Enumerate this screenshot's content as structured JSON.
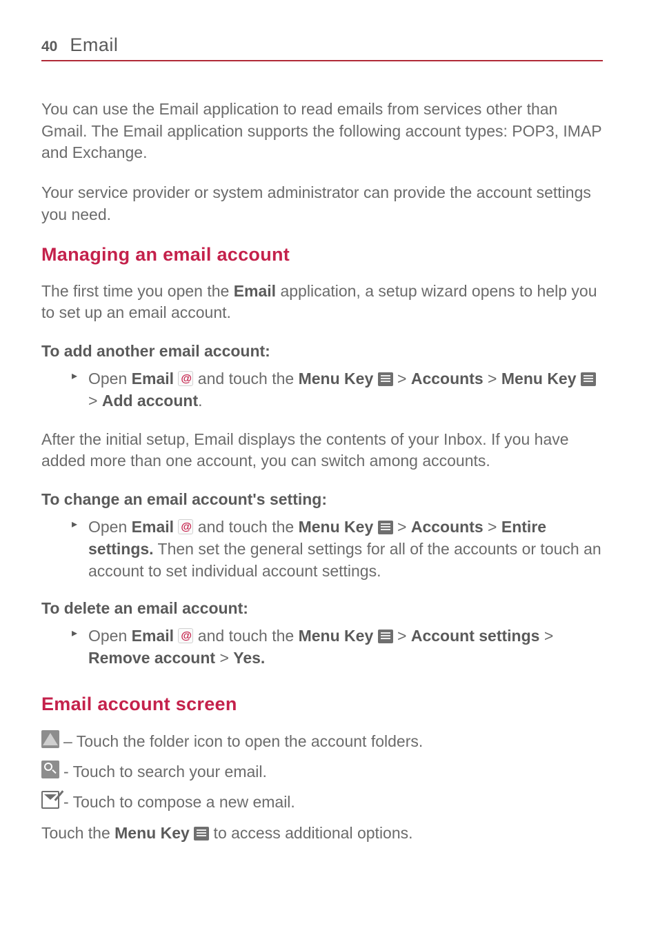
{
  "header": {
    "page_number": "40",
    "chapter": "Email"
  },
  "intro": {
    "p1": "You can use the Email application to read emails from services other than Gmail. The Email application supports the following account types: POP3, IMAP and Exchange.",
    "p2": "Your service provider or system administrator can provide the account settings you need."
  },
  "section_managing": {
    "title": "Managing an email account",
    "intro_pre": "The first time you open the ",
    "intro_bold": "Email",
    "intro_post": " application, a setup wizard opens to help you to set up an email account.",
    "add": {
      "heading": "To add another email account:",
      "s1": "Open ",
      "s2": "Email ",
      "s3": " and touch the ",
      "s4": "Menu Key ",
      "s5": " > ",
      "s6": "Accounts",
      "s7": " > ",
      "s8": "Menu Key ",
      "s9": " > ",
      "s10": "Add account",
      "s11": "."
    },
    "after": "After the initial setup, Email displays the contents of your Inbox. If you have added more than one account, you can switch among accounts.",
    "change": {
      "heading": "To change an email account's setting:",
      "s1": "Open ",
      "s2": "Email ",
      "s3": " and touch the ",
      "s4": "Menu Key ",
      "s5": " > ",
      "s6": "Accounts",
      "s7": " > ",
      "s8": "Entire settings.",
      "s9": " Then set the general settings for all of the accounts or touch an account to set individual account settings."
    },
    "delete": {
      "heading": "To delete an email account:",
      "s1": "Open ",
      "s2": "Email ",
      "s3": " and touch the ",
      "s4": "Menu Key ",
      "s5": " > ",
      "s6": "Account settings",
      "s7": " > ",
      "s8": "Remove account",
      "s9": " > ",
      "s10": "Yes.",
      "s11": ""
    }
  },
  "section_screen": {
    "title": "Email account screen",
    "rows": {
      "folder": " – Touch the folder icon to open the account folders.",
      "search": " - Touch to search your email.",
      "compose": " - Touch to compose a new email."
    },
    "footer_pre": "Touch the ",
    "footer_bold": "Menu Key ",
    "footer_post": " to access additional options."
  }
}
